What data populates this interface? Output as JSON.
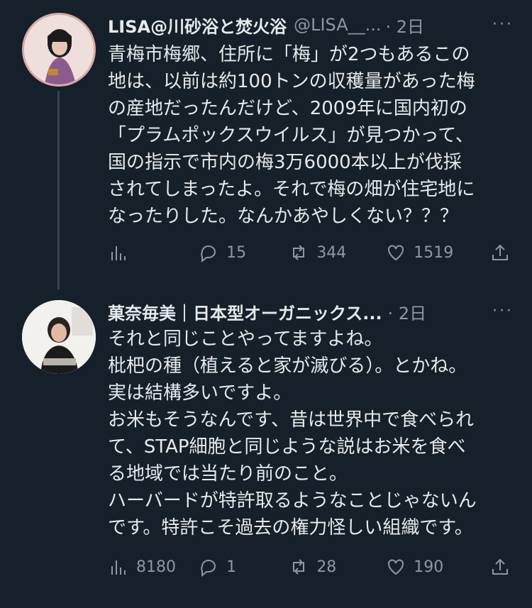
{
  "tweets": [
    {
      "name": "LISA@川砂浴と焚火浴",
      "handle": "@LISA__...",
      "time": "· 2日",
      "more": "···",
      "text": "青梅市梅郷、住所に「梅」が2つもあるこの\n地は、以前は約100トンの収穫量があった梅\nの産地だったんだけど、2009年に国内初の\n「プラムポックスウイルス」が見つかって、\n国の指示で市内の梅3万6000本以上が伐採\nされてしまったよ。それで梅の畑が住宅地に\nなったりした。なんかあやしくない？？？",
      "actions": {
        "views": "",
        "replies": "15",
        "retweets": "344",
        "likes": "1519"
      }
    },
    {
      "name": "菓奈毎美｜日本型オーガニックス...",
      "handle": "",
      "time": "· 2日",
      "more": "···",
      "text": "それと同じことやってますよね。\n枇杷の種（植えると家が滅びる）。とかね。\n実は結構多いですよ。\nお米もそうなんです、昔は世界中で食べられ\nて、STAP細胞と同じような説はお米を食べ\nる地域では当たり前のこと。\nハーバードが特許取るようなことじゃないん\nです。特許こそ過去の権力怪しい組織です。",
      "actions": {
        "views": "8180",
        "replies": "1",
        "retweets": "28",
        "likes": "190"
      }
    }
  ],
  "colors": {
    "background": "#15202b",
    "text": "#e7e9ea",
    "secondary": "#8b98a5",
    "thread_line": "#38444d"
  },
  "icons": [
    "views-icon",
    "reply-icon",
    "retweet-icon",
    "like-icon",
    "share-icon"
  ]
}
